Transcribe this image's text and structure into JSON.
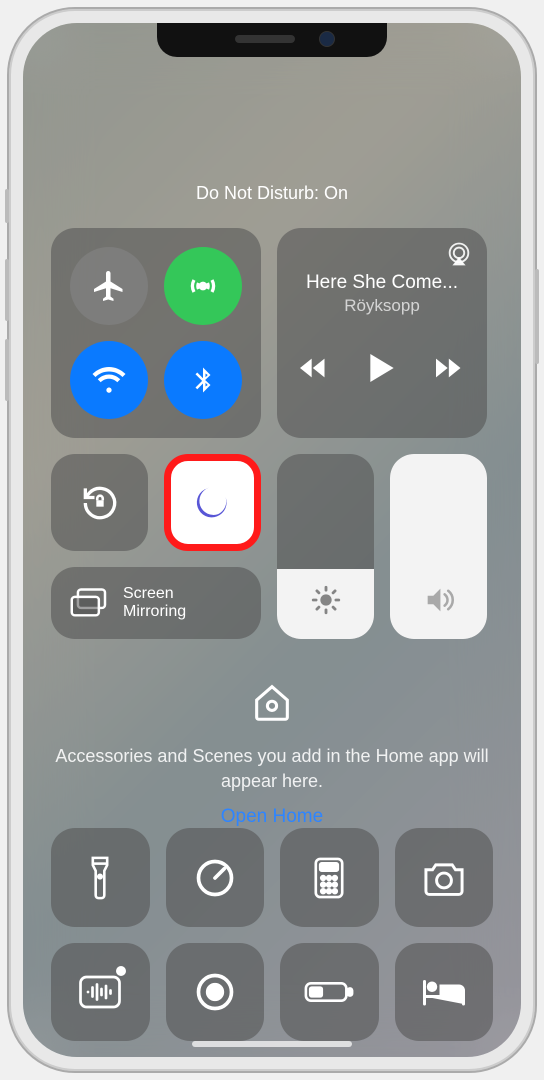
{
  "status": {
    "text": "Do Not Disturb: On"
  },
  "connectivity": {
    "airplane": false,
    "cellular": true,
    "wifi": true,
    "bluetooth": true
  },
  "media": {
    "title": "Here She Come...",
    "artist": "Röyksopp"
  },
  "mirroring": {
    "label": "Screen\nMirroring"
  },
  "sliders": {
    "brightness_percent": 38,
    "volume_percent": 100
  },
  "home": {
    "message": "Accessories and Scenes you add in the Home app will appear here.",
    "link": "Open Home"
  },
  "bottom": {
    "items": [
      "flashlight",
      "timer",
      "calculator",
      "camera",
      "voice-memos",
      "screen-record",
      "low-power",
      "sleep"
    ]
  },
  "highlight": {
    "dnd_tile": true
  }
}
